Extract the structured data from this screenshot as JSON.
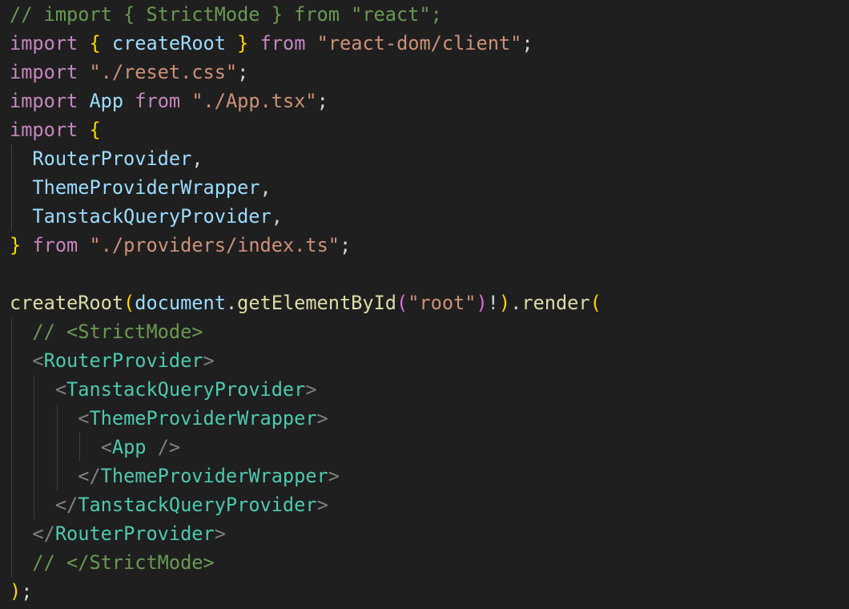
{
  "colors": {
    "background": "#1f1f1f",
    "comment": "#6a9955",
    "keyword": "#c586c0",
    "string": "#ce9178",
    "variable": "#9cdcfe",
    "function": "#dcdcaa",
    "jsx_tag": "#4ec9b0",
    "punctuation": "#d4d4d4",
    "bracket_gold": "#ffd700",
    "bracket_pink": "#da70d6",
    "bracket_blue": "#179fff",
    "tag_bracket": "#808080",
    "indent_guide": "#404040"
  },
  "code": {
    "lines": [
      {
        "tokens": [
          {
            "t": "// import { StrictMode } from \"react\";",
            "c": "comment"
          }
        ]
      },
      {
        "tokens": [
          {
            "t": "import",
            "c": "keyword"
          },
          {
            "t": " ",
            "c": "punctuation"
          },
          {
            "t": "{",
            "c": "bracket_gold"
          },
          {
            "t": " ",
            "c": "punctuation"
          },
          {
            "t": "createRoot",
            "c": "variable"
          },
          {
            "t": " ",
            "c": "punctuation"
          },
          {
            "t": "}",
            "c": "bracket_gold"
          },
          {
            "t": " ",
            "c": "punctuation"
          },
          {
            "t": "from",
            "c": "keyword"
          },
          {
            "t": " ",
            "c": "punctuation"
          },
          {
            "t": "\"react-dom/client\"",
            "c": "string"
          },
          {
            "t": ";",
            "c": "punctuation"
          }
        ]
      },
      {
        "tokens": [
          {
            "t": "import",
            "c": "keyword"
          },
          {
            "t": " ",
            "c": "punctuation"
          },
          {
            "t": "\"./reset.css\"",
            "c": "string"
          },
          {
            "t": ";",
            "c": "punctuation"
          }
        ]
      },
      {
        "tokens": [
          {
            "t": "import",
            "c": "keyword"
          },
          {
            "t": " ",
            "c": "punctuation"
          },
          {
            "t": "App",
            "c": "variable"
          },
          {
            "t": " ",
            "c": "punctuation"
          },
          {
            "t": "from",
            "c": "keyword"
          },
          {
            "t": " ",
            "c": "punctuation"
          },
          {
            "t": "\"./App.tsx\"",
            "c": "string"
          },
          {
            "t": ";",
            "c": "punctuation"
          }
        ]
      },
      {
        "tokens": [
          {
            "t": "import",
            "c": "keyword"
          },
          {
            "t": " ",
            "c": "punctuation"
          },
          {
            "t": "{",
            "c": "bracket_gold"
          }
        ]
      },
      {
        "tokens": [
          {
            "t": "  ",
            "c": "punctuation"
          },
          {
            "t": "RouterProvider",
            "c": "variable"
          },
          {
            "t": ",",
            "c": "punctuation"
          }
        ]
      },
      {
        "tokens": [
          {
            "t": "  ",
            "c": "punctuation"
          },
          {
            "t": "ThemeProviderWrapper",
            "c": "variable"
          },
          {
            "t": ",",
            "c": "punctuation"
          }
        ]
      },
      {
        "tokens": [
          {
            "t": "  ",
            "c": "punctuation"
          },
          {
            "t": "TanstackQueryProvider",
            "c": "variable"
          },
          {
            "t": ",",
            "c": "punctuation"
          }
        ]
      },
      {
        "tokens": [
          {
            "t": "}",
            "c": "bracket_gold"
          },
          {
            "t": " ",
            "c": "punctuation"
          },
          {
            "t": "from",
            "c": "keyword"
          },
          {
            "t": " ",
            "c": "punctuation"
          },
          {
            "t": "\"./providers/index.ts\"",
            "c": "string"
          },
          {
            "t": ";",
            "c": "punctuation"
          }
        ]
      },
      {
        "tokens": []
      },
      {
        "tokens": [
          {
            "t": "createRoot",
            "c": "function"
          },
          {
            "t": "(",
            "c": "bracket_gold"
          },
          {
            "t": "document",
            "c": "variable"
          },
          {
            "t": ".",
            "c": "punctuation"
          },
          {
            "t": "getElementById",
            "c": "function"
          },
          {
            "t": "(",
            "c": "bracket_pink"
          },
          {
            "t": "\"root\"",
            "c": "string"
          },
          {
            "t": ")",
            "c": "bracket_pink"
          },
          {
            "t": "!",
            "c": "punctuation"
          },
          {
            "t": ")",
            "c": "bracket_gold"
          },
          {
            "t": ".",
            "c": "punctuation"
          },
          {
            "t": "render",
            "c": "function"
          },
          {
            "t": "(",
            "c": "bracket_gold"
          }
        ]
      },
      {
        "tokens": [
          {
            "t": "  ",
            "c": "punctuation"
          },
          {
            "t": "// <StrictMode>",
            "c": "comment"
          }
        ]
      },
      {
        "tokens": [
          {
            "t": "  ",
            "c": "punctuation"
          },
          {
            "t": "<",
            "c": "tag_bracket"
          },
          {
            "t": "RouterProvider",
            "c": "jsx_tag"
          },
          {
            "t": ">",
            "c": "tag_bracket"
          }
        ]
      },
      {
        "tokens": [
          {
            "t": "    ",
            "c": "punctuation"
          },
          {
            "t": "<",
            "c": "tag_bracket"
          },
          {
            "t": "TanstackQueryProvider",
            "c": "jsx_tag"
          },
          {
            "t": ">",
            "c": "tag_bracket"
          }
        ]
      },
      {
        "tokens": [
          {
            "t": "      ",
            "c": "punctuation"
          },
          {
            "t": "<",
            "c": "tag_bracket"
          },
          {
            "t": "ThemeProviderWrapper",
            "c": "jsx_tag"
          },
          {
            "t": ">",
            "c": "tag_bracket"
          }
        ]
      },
      {
        "tokens": [
          {
            "t": "        ",
            "c": "punctuation"
          },
          {
            "t": "<",
            "c": "tag_bracket"
          },
          {
            "t": "App",
            "c": "jsx_tag"
          },
          {
            "t": " ",
            "c": "punctuation"
          },
          {
            "t": "/>",
            "c": "tag_bracket"
          }
        ]
      },
      {
        "tokens": [
          {
            "t": "      ",
            "c": "punctuation"
          },
          {
            "t": "</",
            "c": "tag_bracket"
          },
          {
            "t": "ThemeProviderWrapper",
            "c": "jsx_tag"
          },
          {
            "t": ">",
            "c": "tag_bracket"
          }
        ]
      },
      {
        "tokens": [
          {
            "t": "    ",
            "c": "punctuation"
          },
          {
            "t": "</",
            "c": "tag_bracket"
          },
          {
            "t": "TanstackQueryProvider",
            "c": "jsx_tag"
          },
          {
            "t": ">",
            "c": "tag_bracket"
          }
        ]
      },
      {
        "tokens": [
          {
            "t": "  ",
            "c": "punctuation"
          },
          {
            "t": "</",
            "c": "tag_bracket"
          },
          {
            "t": "RouterProvider",
            "c": "jsx_tag"
          },
          {
            "t": ">",
            "c": "tag_bracket"
          }
        ]
      },
      {
        "tokens": [
          {
            "t": "  ",
            "c": "punctuation"
          },
          {
            "t": "// </StrictMode>",
            "c": "comment"
          }
        ]
      },
      {
        "tokens": [
          {
            "t": ")",
            "c": "bracket_gold"
          },
          {
            "t": ";",
            "c": "punctuation"
          }
        ]
      }
    ]
  }
}
